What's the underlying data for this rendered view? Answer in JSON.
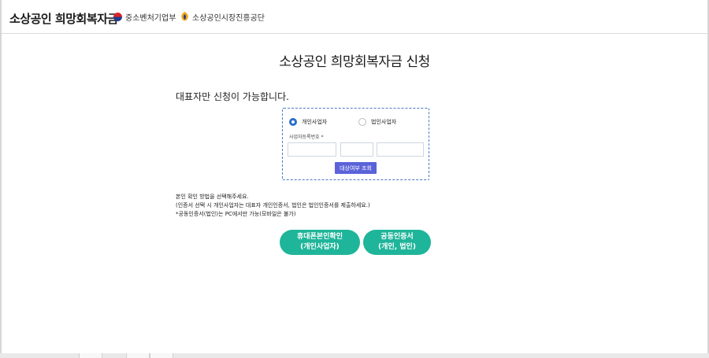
{
  "header": {
    "brand": "소상공인 희망회복자금",
    "org1": "중소벤처기업부",
    "org2": "소상공인시장진흥공단",
    "org1_icon": "taegeuk-icon",
    "org2_icon": "semas-logo-icon"
  },
  "main": {
    "title": "소상공인 희망회복자금 신청",
    "notice": "대표자만 신청이 가능합니다."
  },
  "form": {
    "radio_individual": "개인사업자",
    "radio_corporate": "법인사업자",
    "selected": "개인사업자",
    "reg_label": "사업자등록번호 *",
    "reg_part1": "",
    "reg_part2": "",
    "reg_part3": "",
    "lookup_button": "대상여부 조회"
  },
  "guide": {
    "line1": "본인 확인 방법을 선택해주세요.",
    "line2": "(인증서 선택 시 개인사업자는 대표자 개인인증서, 법인은 법인인증서를 제출하세요.)",
    "line3": "*공동인증서(법인)는 PC에서만 가능(모바일은 불가)"
  },
  "actions": {
    "phone_line1": "휴대폰본인확인",
    "phone_line2": "(개인사업자)",
    "cert_line1": "공동인증서",
    "cert_line2": "(개인, 법인)"
  },
  "colors": {
    "accent_blue": "#2a6fc9",
    "lookup_button": "#5b63d9",
    "action_green": "#1fb59a"
  }
}
